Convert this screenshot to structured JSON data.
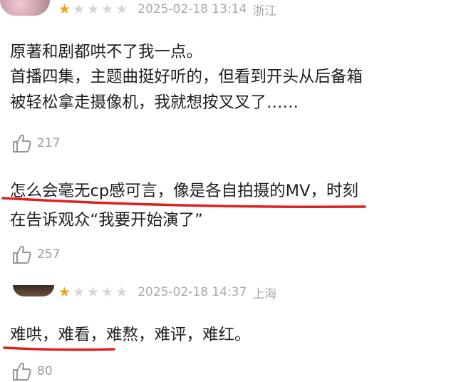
{
  "comments": [
    {
      "rating": 1,
      "date": "2025-02-18 13:14",
      "location": "浙江",
      "text_lines": [
        "原著和剧都哄不了我一点。",
        "首播四集，主题曲挺好听的，但看到开头从后备箱",
        "被轻松拿走摄像机，我就想按叉叉了……"
      ],
      "likes": "217"
    },
    {
      "text_lines": [
        "怎么会毫无cp感可言，像是各自拍摄的MV，时刻",
        "在告诉观众“我要开始演了”"
      ],
      "likes": "257"
    },
    {
      "rating": 1,
      "date": "2025-02-18 14:37",
      "location": "上海",
      "text_lines": [
        "难哄，难看，难熬，难评，难红。"
      ],
      "likes": "80"
    }
  ],
  "colors": {
    "star_on": "#f1a21a",
    "star_off": "#d6d6d6",
    "underline": "#e02020"
  },
  "icons": {
    "like": "thumbs-up-icon",
    "star": "star-icon"
  }
}
